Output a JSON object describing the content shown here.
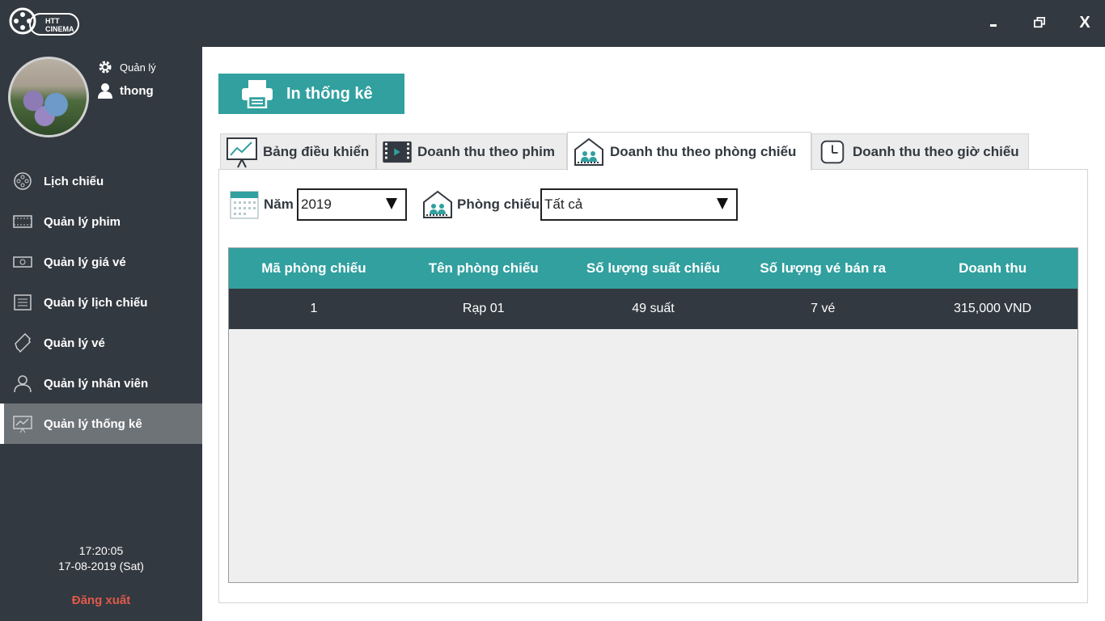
{
  "app": {
    "logo_line1": "HTT",
    "logo_line2": "CINEMA",
    "window_controls": {
      "minimize": "",
      "restore": "",
      "close": "X"
    }
  },
  "user": {
    "role": "Quản lý",
    "name": "thong"
  },
  "sidebar": {
    "items": [
      {
        "label": "Lịch chiếu",
        "icon": "film-reel-icon"
      },
      {
        "label": "Quản lý phim",
        "icon": "film-strip-icon"
      },
      {
        "label": "Quản lý giá vé",
        "icon": "money-icon"
      },
      {
        "label": "Quản lý lịch chiếu",
        "icon": "schedule-list-icon"
      },
      {
        "label": "Quản lý vé",
        "icon": "ticket-icon"
      },
      {
        "label": "Quản lý nhân viên",
        "icon": "employee-icon"
      },
      {
        "label": "Quản lý thống kê",
        "icon": "statistics-icon",
        "active": true
      }
    ],
    "time": "17:20:05",
    "date": "17-08-2019 (Sat)",
    "logout": "Đăng xuất"
  },
  "toolbar": {
    "print_label": "In thống kê"
  },
  "tabs": [
    {
      "label": "Bảng điều khiển",
      "icon": "dashboard-chart-icon"
    },
    {
      "label": "Doanh thu theo phim",
      "icon": "film-icon"
    },
    {
      "label": "Doanh thu theo phòng chiếu",
      "icon": "theater-room-icon",
      "active": true
    },
    {
      "label": "Doanh thu theo giờ chiếu",
      "icon": "clock-icon"
    }
  ],
  "filters": {
    "year_label": "Năm",
    "year_value": "2019",
    "room_label": "Phòng chiếu",
    "room_value": "Tất cả"
  },
  "table": {
    "columns": [
      "Mã phòng chiếu",
      "Tên phòng chiếu",
      "Số lượng suất chiếu",
      "Số lượng vé bán ra",
      "Doanh thu"
    ],
    "rows": [
      [
        "1",
        "Rạp 01",
        "49 suất",
        "7 vé",
        "315,000 VND"
      ]
    ]
  },
  "colors": {
    "dark": "#333940",
    "accent": "#31a09f",
    "logout": "#e05a4a",
    "active_nav": "#6e7378"
  }
}
